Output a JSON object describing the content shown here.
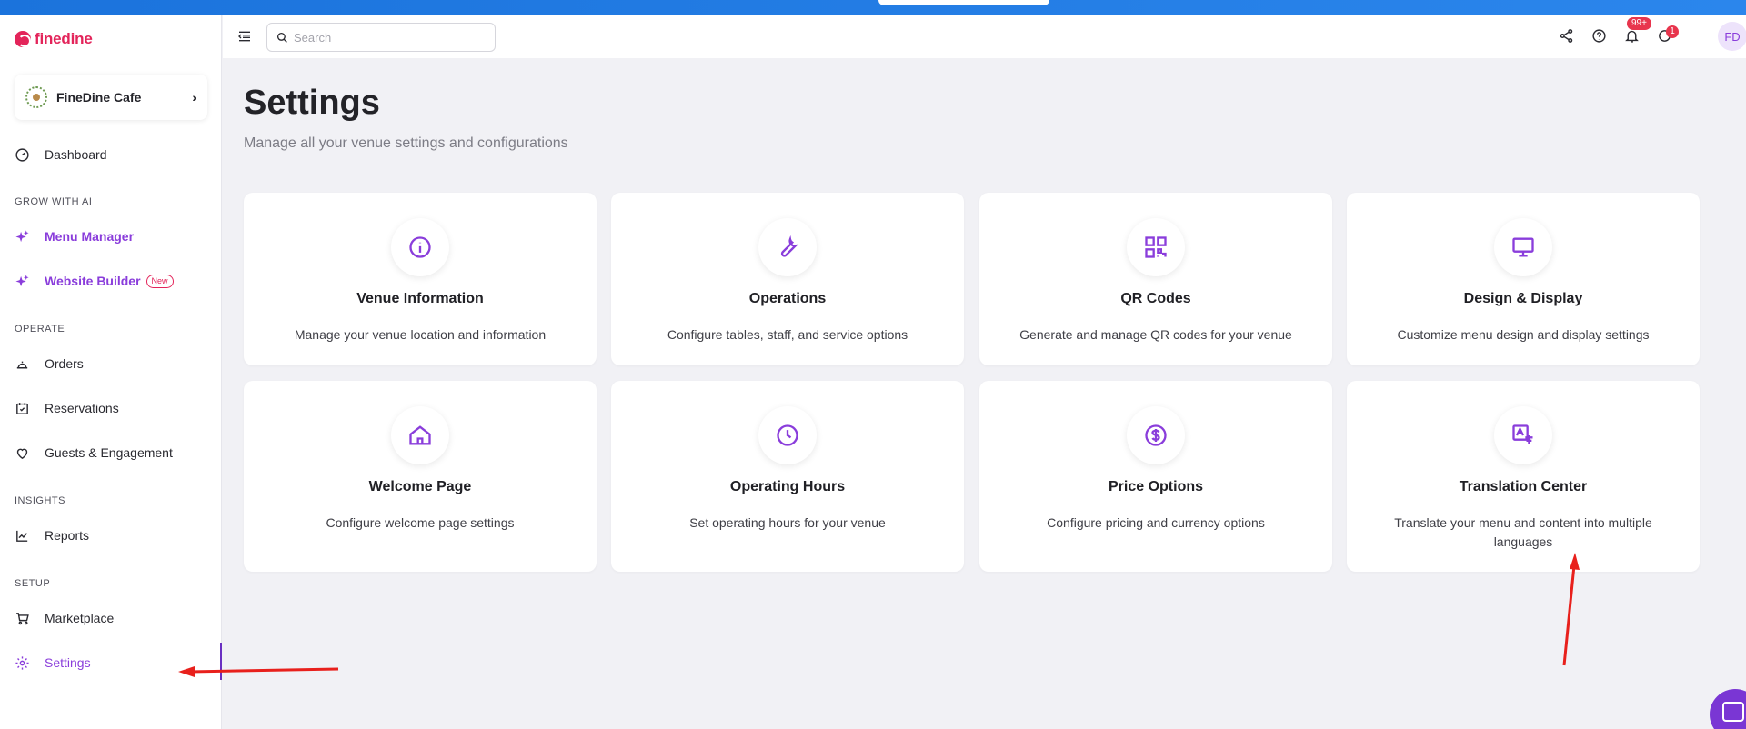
{
  "app": {
    "logo_text": "finedine"
  },
  "venue": {
    "name": "FineDine Cafe"
  },
  "search": {
    "placeholder": "Search"
  },
  "header": {
    "notifications_badge": "99+",
    "alerts_badge": "1",
    "avatar_initials": "FD"
  },
  "sidebar": {
    "dashboard": "Dashboard",
    "section_grow": "GROW WITH AI",
    "menu_manager": "Menu Manager",
    "website_builder": "Website Builder",
    "new_badge": "New",
    "section_operate": "OPERATE",
    "orders": "Orders",
    "reservations": "Reservations",
    "guests": "Guests & Engagement",
    "section_insights": "INSIGHTS",
    "reports": "Reports",
    "section_setup": "SETUP",
    "marketplace": "Marketplace",
    "settings": "Settings"
  },
  "page": {
    "title": "Settings",
    "subtitle": "Manage all your venue settings and configurations"
  },
  "cards": [
    {
      "title": "Venue Information",
      "desc": "Manage your venue location and information",
      "icon": "info-icon"
    },
    {
      "title": "Operations",
      "desc": "Configure tables, staff, and service options",
      "icon": "wrench-icon"
    },
    {
      "title": "QR Codes",
      "desc": "Generate and manage QR codes for your venue",
      "icon": "qr-code-icon"
    },
    {
      "title": "Design & Display",
      "desc": "Customize menu design and display settings",
      "icon": "monitor-icon"
    },
    {
      "title": "Welcome Page",
      "desc": "Configure welcome page settings",
      "icon": "home-icon"
    },
    {
      "title": "Operating Hours",
      "desc": "Set operating hours for your venue",
      "icon": "clock-icon"
    },
    {
      "title": "Price Options",
      "desc": "Configure pricing and currency options",
      "icon": "dollar-icon"
    },
    {
      "title": "Translation Center",
      "desc": "Translate your menu and content into multiple languages",
      "icon": "translate-icon"
    }
  ],
  "colors": {
    "accent": "#8a3ddb",
    "brand": "#e3245a",
    "annotation": "#e8201c"
  }
}
